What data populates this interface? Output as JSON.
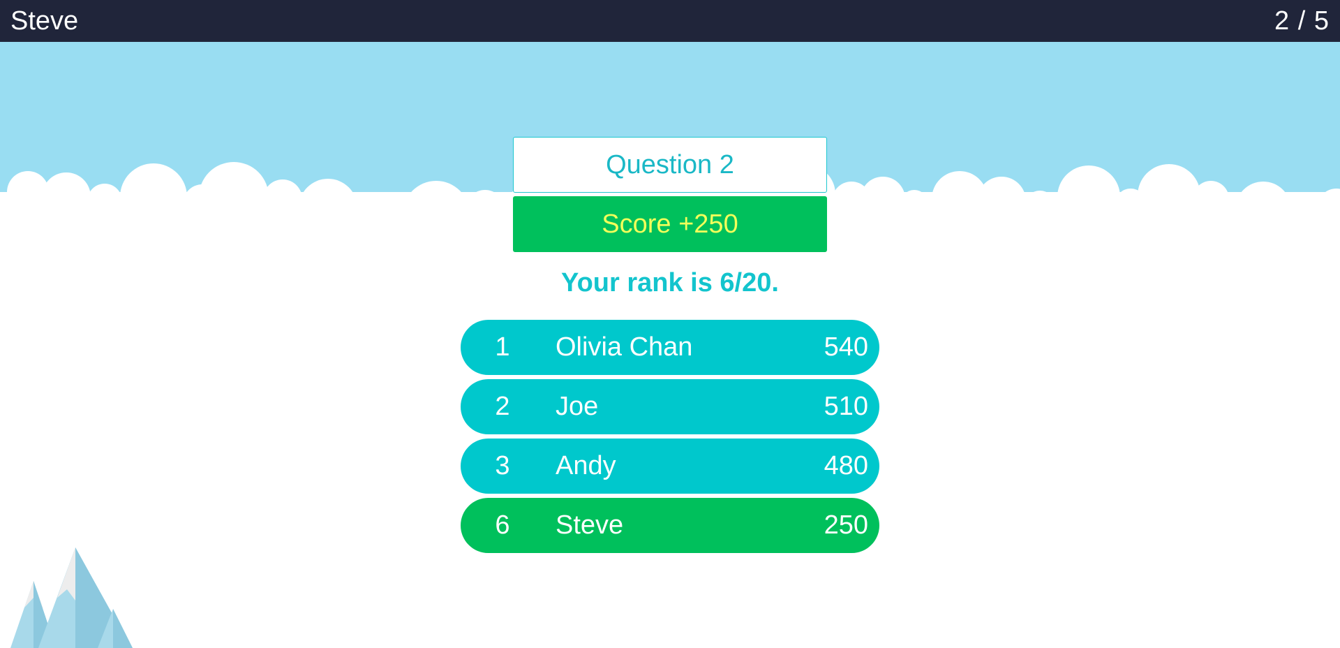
{
  "header": {
    "player_name": "Steve",
    "progress": "2 / 5"
  },
  "colors": {
    "header_bg": "#20253a",
    "sky": "#99ddf2",
    "accent_teal": "#00c8cc",
    "accent_green": "#00c05c",
    "score_text": "#f2ff5a"
  },
  "question": {
    "label": "Question 2"
  },
  "score": {
    "label": "Score +250"
  },
  "rank": {
    "text": "Your rank is 6/20."
  },
  "leaderboard": [
    {
      "rank": "1",
      "name": "Olivia Chan",
      "score": "540"
    },
    {
      "rank": "2",
      "name": "Joe",
      "score": "510"
    },
    {
      "rank": "3",
      "name": "Andy",
      "score": "480"
    },
    {
      "rank": "6",
      "name": "Steve",
      "score": "250",
      "current_player": true
    }
  ]
}
